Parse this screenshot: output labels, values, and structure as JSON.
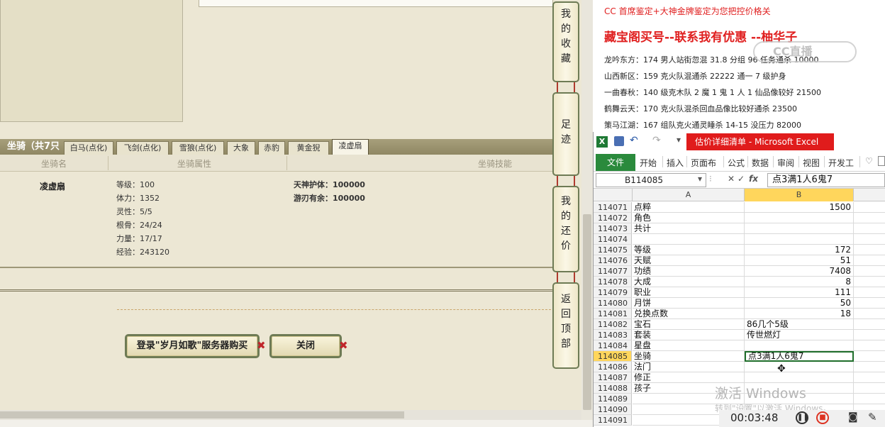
{
  "game": {
    "mount_count": "坐骑（共7只",
    "tabs": [
      "白马(点化)",
      "飞剑(点化)",
      "雪狼(点化)",
      "大象",
      "赤豹",
      "黄金猊",
      "凌虚扇"
    ],
    "active_tab": "凌虚扇",
    "headers": {
      "name": "坐骑名",
      "attrs": "坐骑属性",
      "skills": "坐骑技能"
    },
    "mount": {
      "name": "凌虚扇",
      "attrs": [
        "等级：100",
        "体力：1352",
        "灵性：5/5",
        "根骨：24/24",
        "力量：17/17",
        "经验：243120"
      ],
      "skills": [
        "天神护体：100000",
        "游刃有余：100000"
      ]
    },
    "buttons": {
      "login_buy": "登录\"岁月如歌\"服务器购买",
      "close": "关闭"
    },
    "side_buttons": [
      "我的收藏",
      "足迹",
      "我的还价",
      "返回顶部"
    ]
  },
  "article": {
    "promo": "CC 首席鉴定+大神金牌鉴定为您把控价格关",
    "headline": "藏宝阁买号--联系我有优惠 --柚华子",
    "lines": [
      "龙吟东方：174 男人站街忽混 31.8 分组 96 任务通杀 10000",
      "山西新区：159 克火队混通杀 22222 通一 7 级护身",
      "一曲春秋：140 级克木队 2 魔 1 鬼 1 人 1 仙品像较好 21500",
      "鹤舞云天：170 克火队混杀回血品像比较好通杀 23500",
      "策马江湖：167 组队克火通灵睡杀 14-15 没压力 82000"
    ],
    "watermark": "CC直播"
  },
  "excel": {
    "title": "估价详细清单 - Microsoft Excel",
    "file_tab": "文件",
    "ribbon_tabs": [
      "开始",
      "插入",
      "页面布",
      "公式",
      "数据",
      "审阅",
      "视图",
      "开发工"
    ],
    "name_box": "B114085",
    "formula": "点3满1人6鬼7",
    "columns": [
      "A",
      "B"
    ],
    "rows": [
      {
        "n": "114071",
        "a": "点粹",
        "b": "1500",
        "num": true
      },
      {
        "n": "114072",
        "a": "角色",
        "b": ""
      },
      {
        "n": "114073",
        "a": "共计",
        "b": ""
      },
      {
        "n": "114074",
        "a": "",
        "b": ""
      },
      {
        "n": "114075",
        "a": "等级",
        "b": "172",
        "num": true
      },
      {
        "n": "114076",
        "a": "天赋",
        "b": "51",
        "num": true
      },
      {
        "n": "114077",
        "a": "功绩",
        "b": "7408",
        "num": true
      },
      {
        "n": "114078",
        "a": "大成",
        "b": "8",
        "num": true
      },
      {
        "n": "114079",
        "a": "职业",
        "b": "111",
        "num": true
      },
      {
        "n": "114080",
        "a": "月饼",
        "b": "50",
        "num": true
      },
      {
        "n": "114081",
        "a": "兑换点数",
        "b": "18",
        "num": true
      },
      {
        "n": "114082",
        "a": "宝石",
        "b": "86几个5级"
      },
      {
        "n": "114083",
        "a": "套装",
        "b": "传世燃灯"
      },
      {
        "n": "114084",
        "a": "星盘",
        "b": ""
      },
      {
        "n": "114085",
        "a": "坐骑",
        "b": "点3满1人6鬼7",
        "active": true
      },
      {
        "n": "114086",
        "a": "法门",
        "b": ""
      },
      {
        "n": "114087",
        "a": "修正",
        "b": ""
      },
      {
        "n": "114088",
        "a": "孩子",
        "b": ""
      },
      {
        "n": "114089",
        "a": "",
        "b": ""
      },
      {
        "n": "114090",
        "a": "",
        "b": ""
      },
      {
        "n": "114091",
        "a": "",
        "b": ""
      }
    ]
  },
  "windows_watermark": {
    "line1": "激活 Windows",
    "line2": "转到\"设置\"以激活 Windows。"
  },
  "recorder": {
    "time": "00:03:48"
  }
}
